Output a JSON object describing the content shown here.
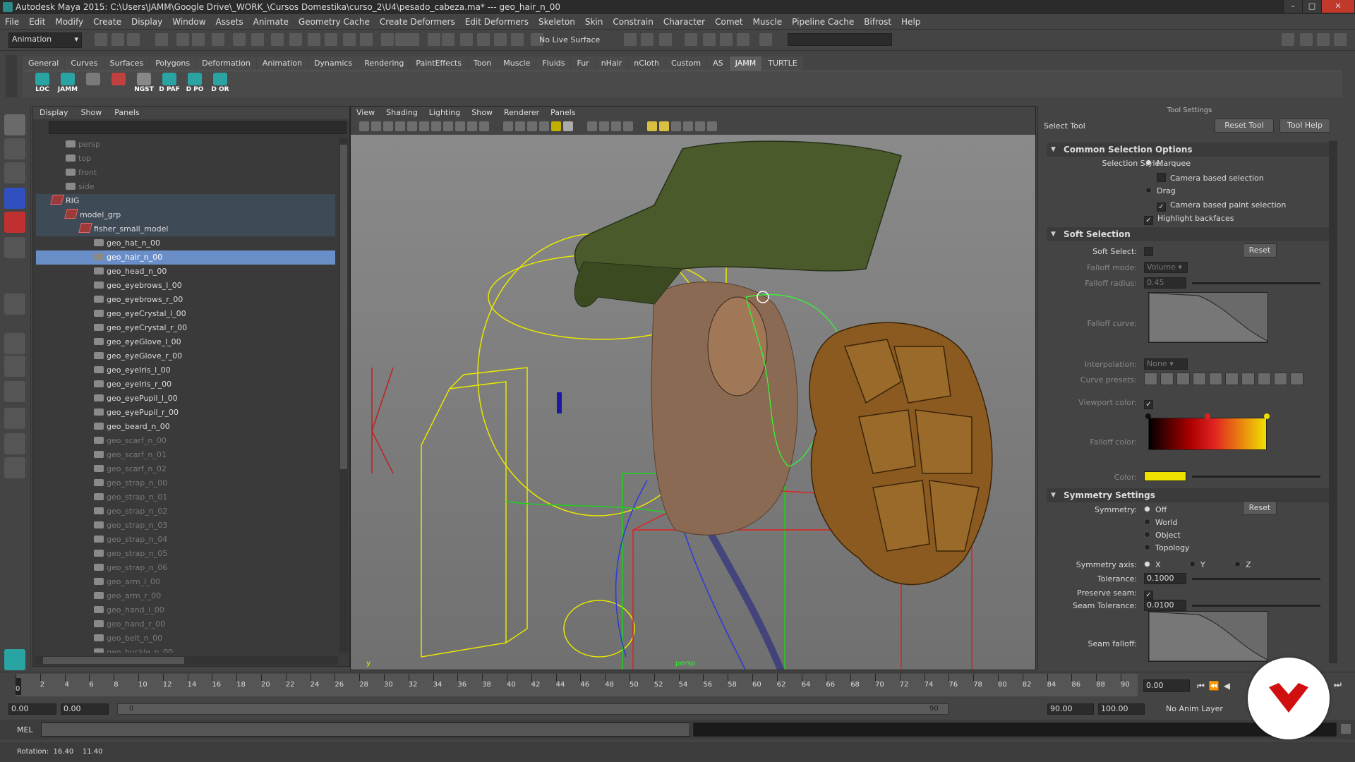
{
  "window": {
    "title": "Autodesk Maya 2015: C:\\Users\\JAMM\\Google Drive\\_WORK_\\Cursos Domestika\\curso_2\\U4\\pesado_cabeza.ma*  ---  geo_hair_n_00"
  },
  "menubar": [
    "File",
    "Edit",
    "Modify",
    "Create",
    "Display",
    "Window",
    "Assets",
    "Animate",
    "Geometry Cache",
    "Create Deformers",
    "Edit Deformers",
    "Skeleton",
    "Skin",
    "Constrain",
    "Character",
    "Comet",
    "Muscle",
    "Pipeline Cache",
    "Bifrost",
    "Help"
  ],
  "statusline": {
    "mode": "Animation",
    "live_surface": "No Live Surface"
  },
  "shelf": {
    "tabs": [
      "General",
      "Curves",
      "Surfaces",
      "Polygons",
      "Deformation",
      "Animation",
      "Dynamics",
      "Rendering",
      "PaintEffects",
      "Toon",
      "Muscle",
      "Fluids",
      "Fur",
      "nHair",
      "nCloth",
      "Custom",
      "AS",
      "JAMM",
      "TURTLE"
    ],
    "active_tab": "JAMM",
    "buttons": [
      "LOC",
      "JAMM",
      "",
      "",
      "NGST",
      "D PAF",
      "D PO",
      "D OR"
    ]
  },
  "outliner": {
    "menu": [
      "Display",
      "Show",
      "Panels"
    ],
    "items": [
      {
        "label": "persp",
        "indent": 0,
        "type": "camera",
        "dim": true
      },
      {
        "label": "top",
        "indent": 0,
        "type": "camera",
        "dim": true
      },
      {
        "label": "front",
        "indent": 0,
        "type": "camera",
        "dim": true
      },
      {
        "label": "side",
        "indent": 0,
        "type": "camera",
        "dim": true
      },
      {
        "label": "RIG",
        "indent": 0,
        "type": "group",
        "parent": true
      },
      {
        "label": "model_grp",
        "indent": 1,
        "type": "group",
        "parent": true
      },
      {
        "label": "fisher_small_model",
        "indent": 2,
        "type": "group",
        "parent": true
      },
      {
        "label": "geo_hat_n_00",
        "indent": 3,
        "type": "mesh"
      },
      {
        "label": "geo_hair_n_00",
        "indent": 3,
        "type": "mesh",
        "selected": true
      },
      {
        "label": "geo_head_n_00",
        "indent": 3,
        "type": "mesh"
      },
      {
        "label": "geo_eyebrows_l_00",
        "indent": 3,
        "type": "mesh"
      },
      {
        "label": "geo_eyebrows_r_00",
        "indent": 3,
        "type": "mesh"
      },
      {
        "label": "geo_eyeCrystal_l_00",
        "indent": 3,
        "type": "mesh"
      },
      {
        "label": "geo_eyeCrystal_r_00",
        "indent": 3,
        "type": "mesh"
      },
      {
        "label": "geo_eyeGlove_l_00",
        "indent": 3,
        "type": "mesh"
      },
      {
        "label": "geo_eyeGlove_r_00",
        "indent": 3,
        "type": "mesh"
      },
      {
        "label": "geo_eyeIris_l_00",
        "indent": 3,
        "type": "mesh"
      },
      {
        "label": "geo_eyeIris_r_00",
        "indent": 3,
        "type": "mesh"
      },
      {
        "label": "geo_eyePupil_l_00",
        "indent": 3,
        "type": "mesh"
      },
      {
        "label": "geo_eyePupil_r_00",
        "indent": 3,
        "type": "mesh"
      },
      {
        "label": "geo_beard_n_00",
        "indent": 3,
        "type": "mesh"
      },
      {
        "label": "geo_scarf_n_00",
        "indent": 3,
        "type": "mesh",
        "dim": true
      },
      {
        "label": "geo_scarf_n_01",
        "indent": 3,
        "type": "mesh",
        "dim": true
      },
      {
        "label": "geo_scarf_n_02",
        "indent": 3,
        "type": "mesh",
        "dim": true
      },
      {
        "label": "geo_strap_n_00",
        "indent": 3,
        "type": "mesh",
        "dim": true
      },
      {
        "label": "geo_strap_n_01",
        "indent": 3,
        "type": "mesh",
        "dim": true
      },
      {
        "label": "geo_strap_n_02",
        "indent": 3,
        "type": "mesh",
        "dim": true
      },
      {
        "label": "geo_strap_n_03",
        "indent": 3,
        "type": "mesh",
        "dim": true
      },
      {
        "label": "geo_strap_n_04",
        "indent": 3,
        "type": "mesh",
        "dim": true
      },
      {
        "label": "geo_strap_n_05",
        "indent": 3,
        "type": "mesh",
        "dim": true
      },
      {
        "label": "geo_strap_n_06",
        "indent": 3,
        "type": "mesh",
        "dim": true
      },
      {
        "label": "geo_arm_l_00",
        "indent": 3,
        "type": "mesh",
        "dim": true
      },
      {
        "label": "geo_arm_r_00",
        "indent": 3,
        "type": "mesh",
        "dim": true
      },
      {
        "label": "geo_hand_l_00",
        "indent": 3,
        "type": "mesh",
        "dim": true
      },
      {
        "label": "geo_hand_r_00",
        "indent": 3,
        "type": "mesh",
        "dim": true
      },
      {
        "label": "geo_belt_n_00",
        "indent": 3,
        "type": "mesh",
        "dim": true
      },
      {
        "label": "geo_buckle_n_00",
        "indent": 3,
        "type": "mesh",
        "dim": true
      }
    ]
  },
  "viewport": {
    "menu": [
      "View",
      "Shading",
      "Lighting",
      "Show",
      "Renderer",
      "Panels"
    ],
    "camera_label": "persp"
  },
  "tool_settings": {
    "header": "Tool Settings",
    "tool_name": "Select Tool",
    "reset_tool": "Reset Tool",
    "tool_help": "Tool Help",
    "common": {
      "title": "Common Selection Options",
      "selection_style_label": "Selection Style:",
      "marquee": "Marquee",
      "camera_based_selection": "Camera based selection",
      "drag": "Drag",
      "camera_based_paint": "Camera based paint selection",
      "highlight_backfaces": "Highlight backfaces"
    },
    "soft": {
      "title": "Soft Selection",
      "soft_select_label": "Soft Select:",
      "reset": "Reset",
      "falloff_mode_label": "Falloff mode:",
      "falloff_mode": "Volume",
      "falloff_radius_label": "Falloff radius:",
      "falloff_radius": "0.45",
      "falloff_curve_label": "Falloff curve:",
      "interpolation_label": "Interpolation:",
      "interpolation": "None",
      "curve_presets_label": "Curve presets:",
      "viewport_color_label": "Viewport color:",
      "falloff_color_label": "Falloff color:",
      "color_label": "Color:",
      "color_swatch": "#f0e000"
    },
    "symmetry": {
      "title": "Symmetry Settings",
      "symmetry_label": "Symmetry:",
      "reset": "Reset",
      "options": [
        "Off",
        "World",
        "Object",
        "Topology"
      ],
      "axis_label": "Symmetry axis:",
      "axes": [
        "X",
        "Y",
        "Z"
      ],
      "tolerance_label": "Tolerance:",
      "tolerance": "0.1000",
      "preserve_seam_label": "Preserve seam:",
      "seam_tolerance_label": "Seam Tolerance:",
      "seam_tolerance": "0.0100",
      "seam_falloff_label": "Seam falloff:"
    }
  },
  "timeline": {
    "ticks": [
      "0",
      "2",
      "4",
      "6",
      "8",
      "10",
      "12",
      "14",
      "16",
      "18",
      "20",
      "22",
      "24",
      "26",
      "28",
      "30",
      "32",
      "34",
      "36",
      "38",
      "40",
      "42",
      "44",
      "46",
      "48",
      "50",
      "52",
      "54",
      "56",
      "58",
      "60",
      "62",
      "64",
      "66",
      "68",
      "70",
      "72",
      "74",
      "76",
      "78",
      "80",
      "82",
      "84",
      "86",
      "88",
      "90"
    ],
    "current_frame": "0.00",
    "current_marker": "0"
  },
  "range": {
    "start": "0.00",
    "start2": "0.00",
    "slider_start": "0",
    "slider_end": "90",
    "end": "90.00",
    "end2": "100.00",
    "anim_layer": "No Anim Layer"
  },
  "command_line": {
    "label": "MEL"
  },
  "help_line": {
    "text": "Rotation:  16.40    11.40"
  }
}
